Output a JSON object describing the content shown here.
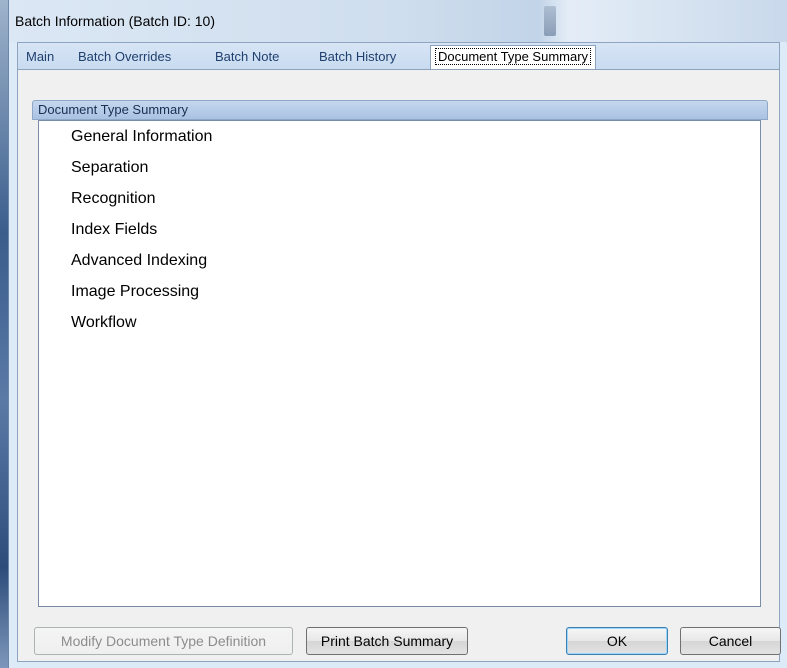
{
  "window": {
    "title": "Batch Information (Batch ID: 10)"
  },
  "tabs": [
    {
      "label": "Main"
    },
    {
      "label": "Batch Overrides"
    },
    {
      "label": "Batch Note"
    },
    {
      "label": "Batch History"
    },
    {
      "label": "Document Type Summary",
      "active": true
    }
  ],
  "panel": {
    "header": "Document Type Summary",
    "items": [
      "General Information",
      "Separation",
      "Recognition",
      "Index Fields",
      "Advanced Indexing",
      "Image Processing",
      "Workflow"
    ]
  },
  "buttons": {
    "modify": "Modify Document Type Definition",
    "print": "Print Batch Summary",
    "ok": "OK",
    "cancel": "Cancel"
  },
  "colors": {
    "tab_text": "#1f3f6e",
    "panel_header": "#c5d7ee",
    "default_button_border": "#3c7fb1"
  }
}
